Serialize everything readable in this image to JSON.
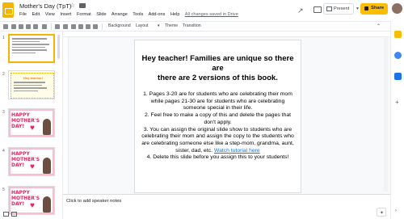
{
  "app": {
    "doc_title": "Mother's Day (TpT)",
    "colors": {
      "accent": "#fbbc04",
      "link": "#1a73e8",
      "selection": "#f4b400"
    }
  },
  "menu": {
    "items": [
      "File",
      "Edit",
      "View",
      "Insert",
      "Format",
      "Slide",
      "Arrange",
      "Tools",
      "Add-ons",
      "Help"
    ],
    "save_status": "All changes saved in Drive"
  },
  "header_actions": {
    "present_label": "Present",
    "share_label": "Share"
  },
  "toolbar": {
    "background_label": "Background",
    "layout_label": "Layout",
    "theme_label": "Theme",
    "transition_label": "Transition"
  },
  "filmstrip": {
    "slides": [
      {
        "number": "1"
      },
      {
        "number": "2",
        "label": "Hey teacher!"
      },
      {
        "number": "3",
        "label": "HAPPY MOTHER'S DAY!"
      },
      {
        "number": "4",
        "label": "HAPPY MOTHER'S DAY!"
      },
      {
        "number": "5",
        "label": "HAPPY MOTHER'S DAY!"
      }
    ]
  },
  "slide": {
    "heading_line1": "Hey teacher!  Families are unique so there are",
    "heading_line2": "there are 2 versions of this book.",
    "items": [
      "1.   Pages 3-20 are for students who are celebrating their mom while pages 21-30 are for students who are celebrating someone special in their life.",
      "2.   Feel free to make a copy of this and delete the pages that don't apply.",
      "3.   You can assign the original slide show to students who are celebrating their mom and assign the copy to the students who are celebrating someone else like a step-mom, grandma, aunt, sister, dad, etc.",
      "4.   Delete this slide before you assign this to your students!"
    ],
    "link_text": "Watch tutorial here"
  },
  "notes": {
    "placeholder": "Click to add speaker notes"
  }
}
